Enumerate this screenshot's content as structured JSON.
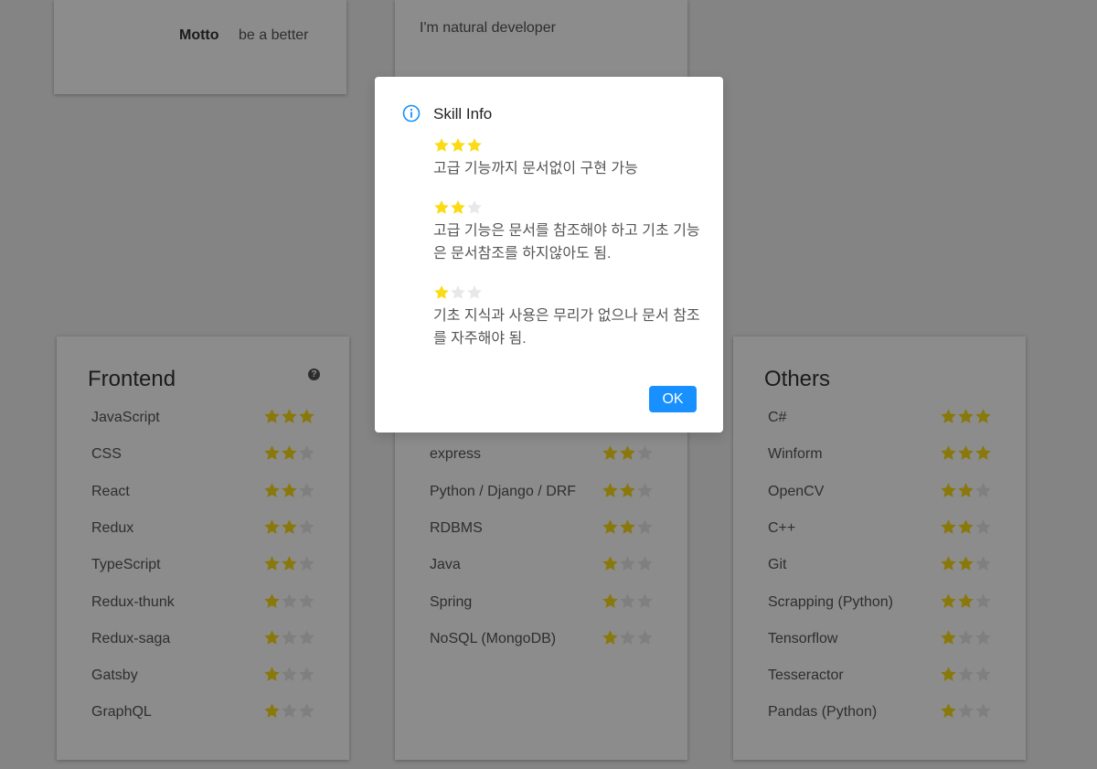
{
  "profile": {
    "motto_label": "Motto",
    "motto_value": "be a better",
    "intro": "I'm natural developer"
  },
  "cards": [
    {
      "title": "Frontend",
      "help_icon": "question-circle-icon",
      "skills": [
        {
          "name": "JavaScript",
          "level": 3
        },
        {
          "name": "CSS",
          "level": 2
        },
        {
          "name": "React",
          "level": 2
        },
        {
          "name": "Redux",
          "level": 2
        },
        {
          "name": "TypeScript",
          "level": 2
        },
        {
          "name": "Redux-thunk",
          "level": 1
        },
        {
          "name": "Redux-saga",
          "level": 1
        },
        {
          "name": "Gatsby",
          "level": 1
        },
        {
          "name": "GraphQL",
          "level": 1
        }
      ]
    },
    {
      "title": "",
      "skills": [
        {
          "name": "",
          "level": 0
        },
        {
          "name": "express",
          "level": 2
        },
        {
          "name": "Python / Django / DRF",
          "level": 2
        },
        {
          "name": "RDBMS",
          "level": 2
        },
        {
          "name": "Java",
          "level": 1
        },
        {
          "name": "Spring",
          "level": 1
        },
        {
          "name": "NoSQL (MongoDB)",
          "level": 1
        }
      ]
    },
    {
      "title": "Others",
      "skills": [
        {
          "name": "C#",
          "level": 3
        },
        {
          "name": "Winform",
          "level": 3
        },
        {
          "name": "OpenCV",
          "level": 2
        },
        {
          "name": "C++",
          "level": 2
        },
        {
          "name": "Git",
          "level": 2
        },
        {
          "name": "Scrapping (Python)",
          "level": 2
        },
        {
          "name": "Tensorflow",
          "level": 1
        },
        {
          "name": "Tesseractor",
          "level": 1
        },
        {
          "name": "Pandas (Python)",
          "level": 1
        }
      ]
    }
  ],
  "star_max": 3,
  "colors": {
    "star_on": "#fadb14",
    "star_off": "#e8e8e8",
    "accent": "#1890ff",
    "overlay": "rgba(0,0,0,0.45)"
  },
  "modal": {
    "icon": "info-circle-icon",
    "title": "Skill Info",
    "levels": [
      {
        "stars": 3,
        "description": "고급 기능까지 문서없이 구현 가능"
      },
      {
        "stars": 2,
        "description": "고급 기능은 문서를 참조해야 하고 기초 기능은 문서참조를 하지않아도 됨."
      },
      {
        "stars": 1,
        "description": "기초 지식과 사용은 무리가 없으나 문서 참조를 자주해야 됨."
      }
    ],
    "ok_label": "OK"
  }
}
